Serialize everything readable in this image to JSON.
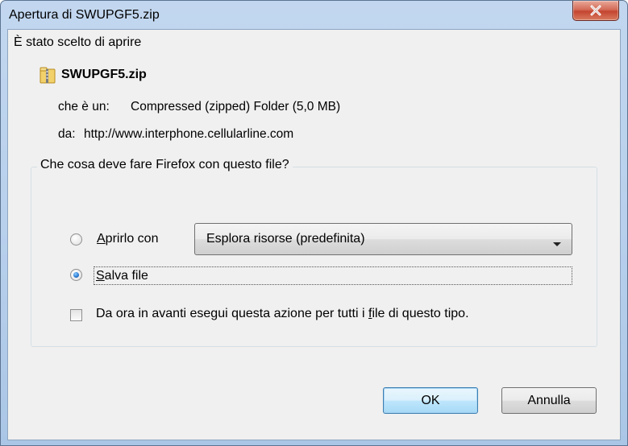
{
  "window": {
    "title": "Apertura di SWUPGF5.zip"
  },
  "dialog": {
    "heading": "È stato scelto di aprire",
    "file_name": "SWUPGF5.zip",
    "file_type_label": "che è un:",
    "file_type_value": "Compressed (zipped) Folder (5,0 MB)",
    "source_label": "da:",
    "source_value": "http://www.interphone.cellularline.com"
  },
  "action_group": {
    "legend": "Che cosa deve fare Firefox con questo file?",
    "open_with_label": "Aprirlo con",
    "open_with_selected": "Esplora risorse (predefinita)",
    "save_file_label": "Salva file",
    "selected_option": "save_file",
    "remember_label_pre": "Da ora in avanti esegui questa azione per tutti i ",
    "remember_label_u": "f",
    "remember_label_post": "ile di questo tipo.",
    "remember_checked": false
  },
  "buttons": {
    "ok": "OK",
    "cancel": "Annulla"
  },
  "colors": {
    "frame": "#b8d0ec",
    "close_button": "#c44530",
    "client_bg": "#f0f0f0",
    "default_button_border": "#3c7fb1"
  },
  "icons": {
    "close": "close-icon",
    "file": "zip-folder-icon",
    "dropdown": "chevron-down-icon"
  }
}
